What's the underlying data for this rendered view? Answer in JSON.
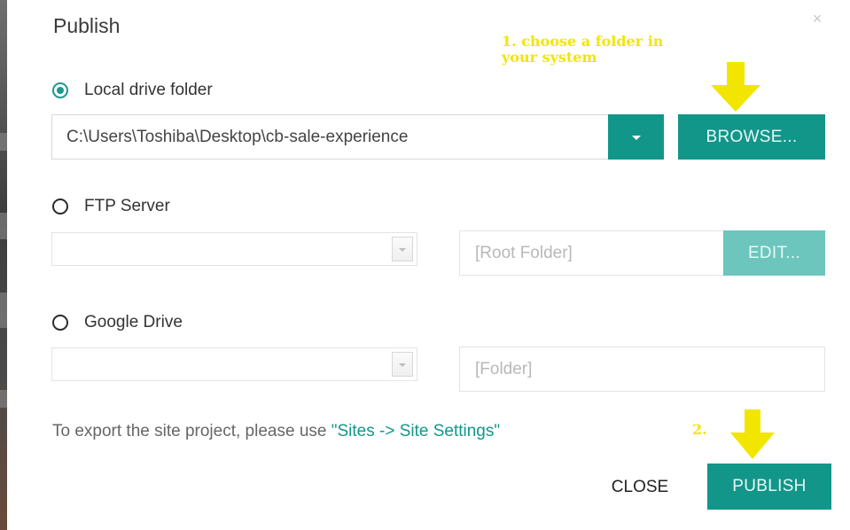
{
  "dialog": {
    "title": "Publish",
    "close_icon": "close-icon",
    "close_glyph": "×"
  },
  "local": {
    "label": "Local drive folder",
    "selected": true,
    "path_value": "C:\\Users\\Toshiba\\Desktop\\cb-sale-experience",
    "dropdown_icon": "caret-down-icon",
    "browse_label": "BROWSE..."
  },
  "ftp": {
    "label": "FTP Server",
    "selected": false,
    "server_value": "",
    "root_folder_placeholder": "[Root Folder]",
    "edit_label": "EDIT..."
  },
  "gdrive": {
    "label": "Google Drive",
    "selected": false,
    "account_value": "",
    "folder_placeholder": "[Folder]"
  },
  "footer": {
    "text": "To export the site project, please use ",
    "link": "\"Sites -> Site Settings\""
  },
  "actions": {
    "close_label": "CLOSE",
    "publish_label": "PUBLISH"
  },
  "annotations": {
    "step1_line1": "1. choose a folder in",
    "step1_line2": "your system",
    "step2": "2.",
    "color": "#f2e600"
  },
  "colors": {
    "accent": "#12968a",
    "accent_disabled": "#6cc6bd"
  }
}
